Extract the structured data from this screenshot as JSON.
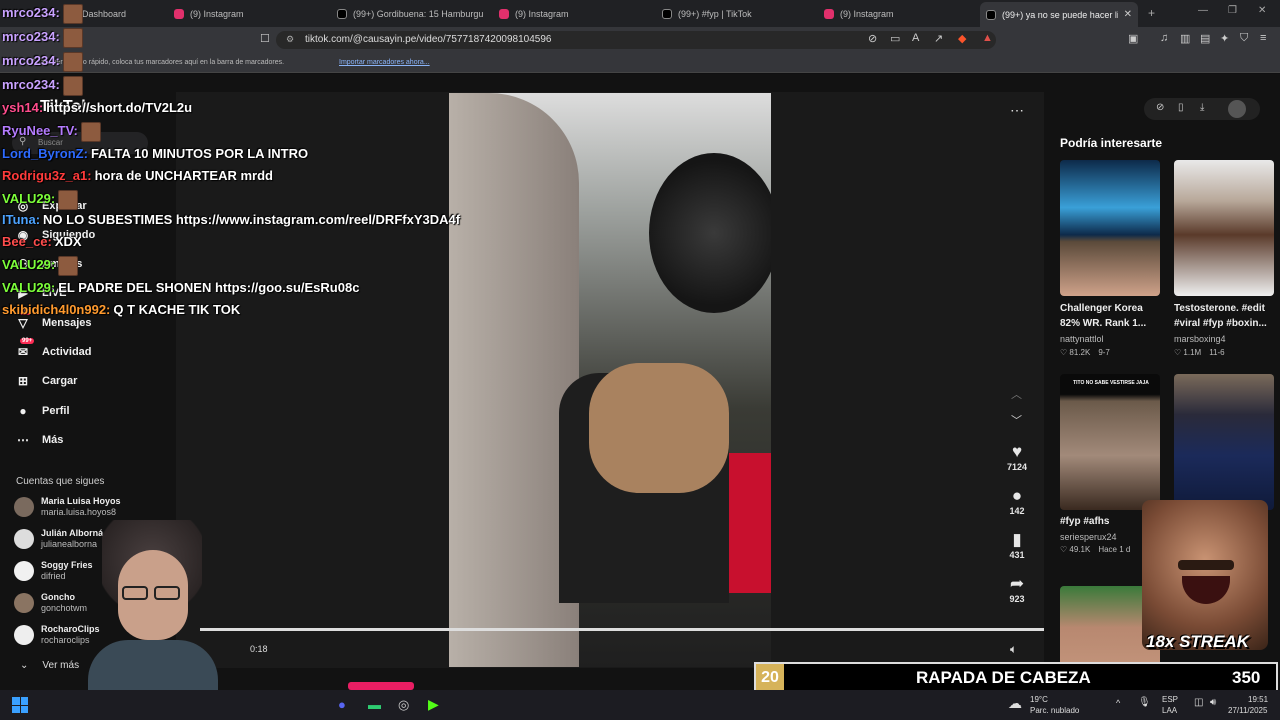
{
  "browser": {
    "tabs": [
      {
        "label": "Dashboard",
        "color": "#b0b0b0"
      },
      {
        "label": "(9) Instagram",
        "color": "#e1306c"
      },
      {
        "label": "(99+) Gordibuena: 15 Hamburguesas",
        "color": "#000000"
      },
      {
        "label": "(9) Instagram",
        "color": "#e1306c"
      },
      {
        "label": "(99+) #fyp | TikTok",
        "color": "#000000"
      },
      {
        "label": "(9) Instagram",
        "color": "#e1306c"
      },
      {
        "label": "(99+) ya no se puede hacer li",
        "color": "#000000"
      }
    ],
    "url": "tiktok.com/@causayin.pe/video/7577187420098104596",
    "bookmarks_hint": "Para tener acceso rápido, coloca tus marcadores aquí en la barra de marcadores.",
    "bookmarks_link": "Importar marcadores ahora..."
  },
  "sidebar": {
    "logo": "TikTok",
    "search_placeholder": "Buscar",
    "items": [
      {
        "label": "Explorar",
        "icon": "compass-icon"
      },
      {
        "label": "Siguiendo",
        "icon": "following-icon"
      },
      {
        "label": "Amigos",
        "icon": "friends-icon"
      },
      {
        "label": "LIVE",
        "icon": "live-icon"
      },
      {
        "label": "Mensajes",
        "icon": "messages-icon",
        "badge": "93"
      },
      {
        "label": "Actividad",
        "icon": "activity-icon",
        "badge": "99+"
      },
      {
        "label": "Cargar",
        "icon": "upload-icon"
      },
      {
        "label": "Perfil",
        "icon": "profile-icon"
      },
      {
        "label": "Más",
        "icon": "more-icon"
      }
    ],
    "following_title": "Cuentas que sigues",
    "accounts": [
      {
        "name": "Maria Luisa Hoyos",
        "handle": "maria.luisa.hoyos8"
      },
      {
        "name": "Julián Alborná",
        "handle": "julianealborna"
      },
      {
        "name": "Soggy Fries",
        "handle": "difried"
      },
      {
        "name": "Goncho",
        "handle": "gonchotwm"
      },
      {
        "name": "RocharoClips",
        "handle": "rocharoclips"
      }
    ],
    "see_more": "Ver más"
  },
  "video": {
    "time": "0:18",
    "actions": {
      "likes": "7124",
      "comments": "142",
      "saves": "431",
      "shares": "923"
    }
  },
  "recommendations": {
    "title": "Podría interesarte",
    "cards": [
      {
        "title": "Challenger Korea 82% WR. Rank 1...",
        "user": "nattynattlol",
        "views": "81.2K",
        "date": "9-7"
      },
      {
        "title": "Testosterone. #edit #viral #fyp #boxin...",
        "user": "marsboxing4",
        "views": "1.1M",
        "date": "11-6"
      },
      {
        "title": "#fyp #afhs",
        "user": "seriesperux24",
        "views": "49.1K",
        "date": "Hace 1 d"
      },
      {
        "title": "",
        "user": "",
        "views": "",
        "date": ""
      }
    ],
    "card3_overlay_text": "TITO NO SABE VESTIRSE JAJA"
  },
  "chat": [
    {
      "user": "mrco234:",
      "color": "#c9a2ff",
      "msg": "",
      "emote": true
    },
    {
      "user": "mrco234:",
      "color": "#c9a2ff",
      "msg": "",
      "emote": true
    },
    {
      "user": "mrco234:",
      "color": "#c9a2ff",
      "msg": "",
      "emote": true
    },
    {
      "user": "mrco234:",
      "color": "#c9a2ff",
      "msg": "",
      "emote": true
    },
    {
      "user": "ysh14:",
      "color": "#ff4d8d",
      "msg": "https://short.do/TV2L2u",
      "emote": false
    },
    {
      "user": "RyuNee_TV:",
      "color": "#b57cff",
      "msg": "",
      "emote": true
    },
    {
      "user": "Lord_ByronZ:",
      "color": "#2e6bff",
      "msg": "FALTA 10 MINUTOS POR LA INTRO",
      "emote": false
    },
    {
      "user": "Rodrigu3z_a1:",
      "color": "#ff3b3b",
      "msg": "hora de UNCHARTEAR mrdd",
      "emote": false
    },
    {
      "user": "VALU29:",
      "color": "#7dff3a",
      "msg": "",
      "emote": true
    },
    {
      "user": "ITuna:",
      "color": "#4da3ff",
      "msg": "NO LO SUBESTIMES https://www.instagram.com/reel/DRFfxY3DA4f",
      "emote": false
    },
    {
      "user": "Bee_ce:",
      "color": "#ff4d4d",
      "msg": "XDX",
      "emote": false
    },
    {
      "user": "VALU29:",
      "color": "#7dff3a",
      "msg": "",
      "emote": true
    },
    {
      "user": "VALU29:",
      "color": "#7dff3a",
      "msg": "EL PADRE DEL SHONEN https://goo.su/EsRu08c",
      "emote": false
    },
    {
      "user": "skibidich4l0n992:",
      "color": "#ff9a2e",
      "msg": "Q T KACHE TIK TOK",
      "emote": false
    }
  ],
  "overlay": {
    "streak": "18x STREAK",
    "timer_count": "20",
    "timer_label": "RAPADA DE CABEZA",
    "timer_value": "350"
  },
  "taskbar": {
    "weather_temp": "19°C",
    "weather_desc": "Parc. nublado",
    "lang1": "ESP",
    "lang2": "LAA",
    "time": "19:51",
    "date": "27/11/2025"
  },
  "colors": {
    "tiktok_red": "#fe2c55",
    "bg": "#121212"
  }
}
